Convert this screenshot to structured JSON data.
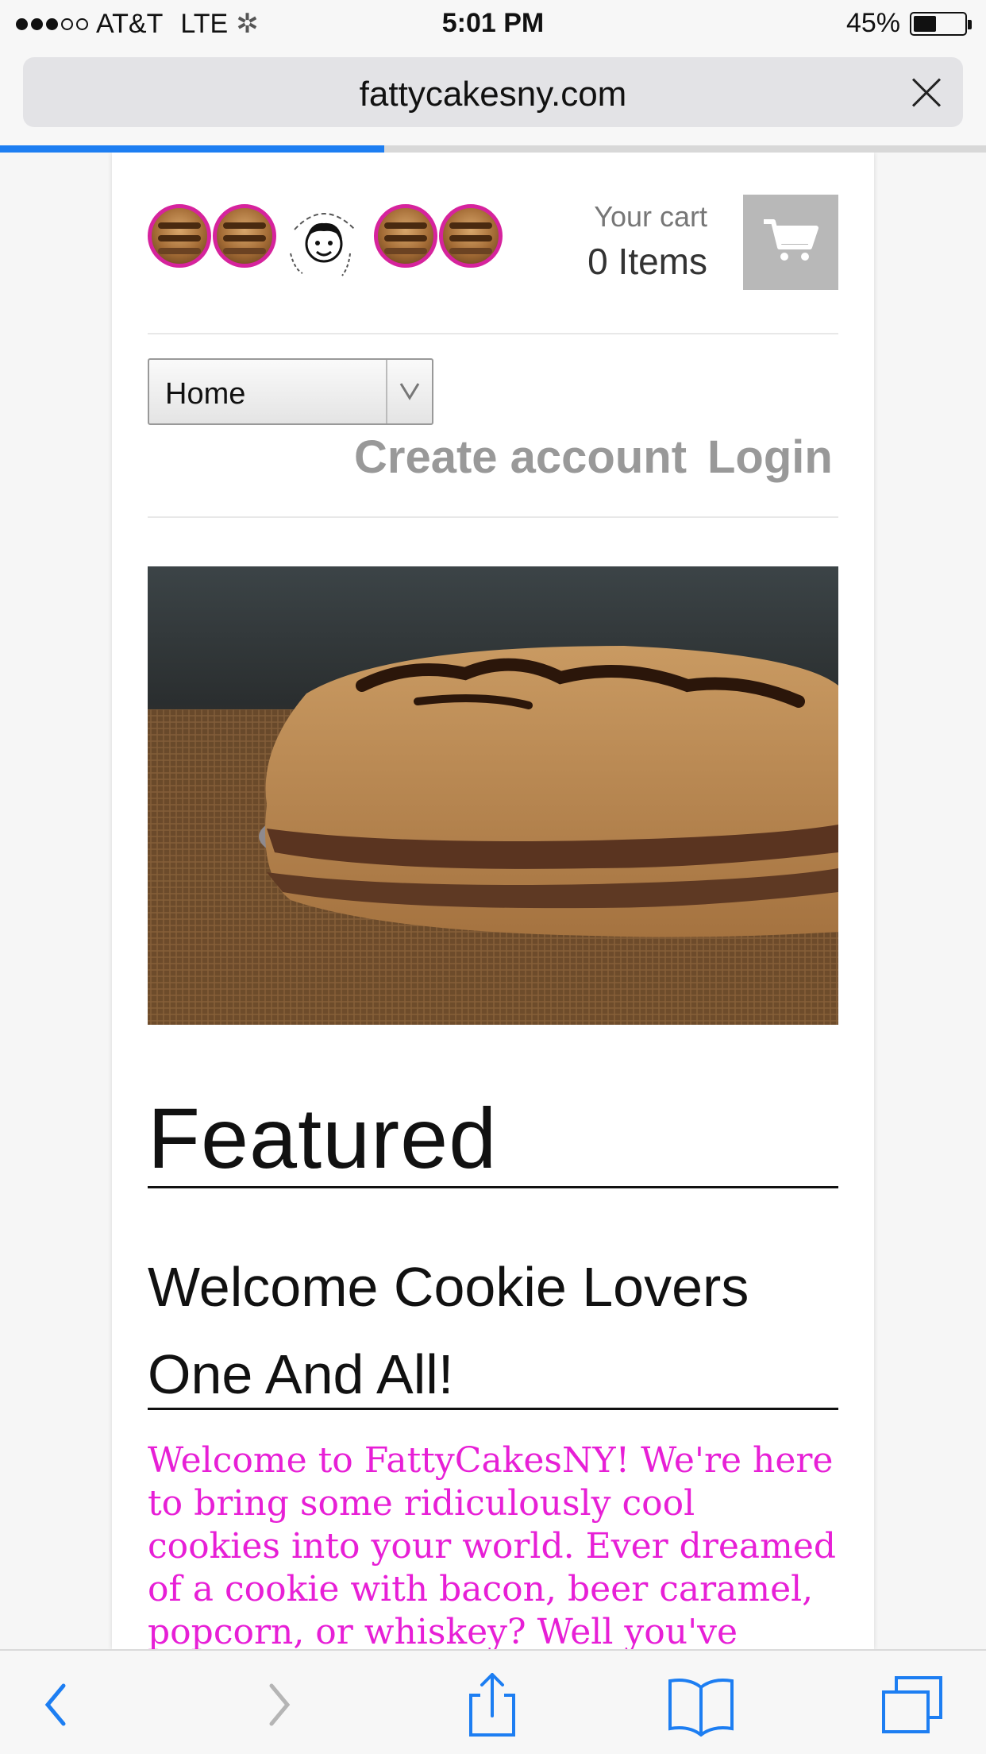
{
  "status_bar": {
    "carrier": "AT&T",
    "network": "LTE",
    "time": "5:01 PM",
    "battery_percent": "45%",
    "battery_level": 0.45,
    "signal_bars_filled": 3,
    "signal_bars_total": 5
  },
  "browser": {
    "url": "fattycakesny.com",
    "load_progress": 0.39
  },
  "header": {
    "cart_label": "Your cart",
    "cart_count": "0 Items"
  },
  "nav": {
    "select_value": "Home",
    "create_account": "Create account",
    "login": "Login"
  },
  "main": {
    "featured_heading": "Featured",
    "welcome_title_line1": "Welcome Cookie Lovers",
    "welcome_title_line2": "One And All!",
    "welcome_text": "Welcome to FattyCakesNY! We're here to bring some ridiculously cool cookies into your world. Ever dreamed of a cookie with bacon, beer caramel, popcorn, or whiskey? Well you've"
  },
  "colors": {
    "accent_pink": "#e71fd6",
    "logo_ring": "#d6239d",
    "ios_blue": "#1d7ef2",
    "link_gray": "#999999"
  },
  "icons": {
    "back": "chevron-left-icon",
    "forward": "chevron-right-icon",
    "share": "share-icon",
    "bookmarks": "book-icon",
    "tabs": "tabs-icon",
    "cart": "cart-icon"
  }
}
